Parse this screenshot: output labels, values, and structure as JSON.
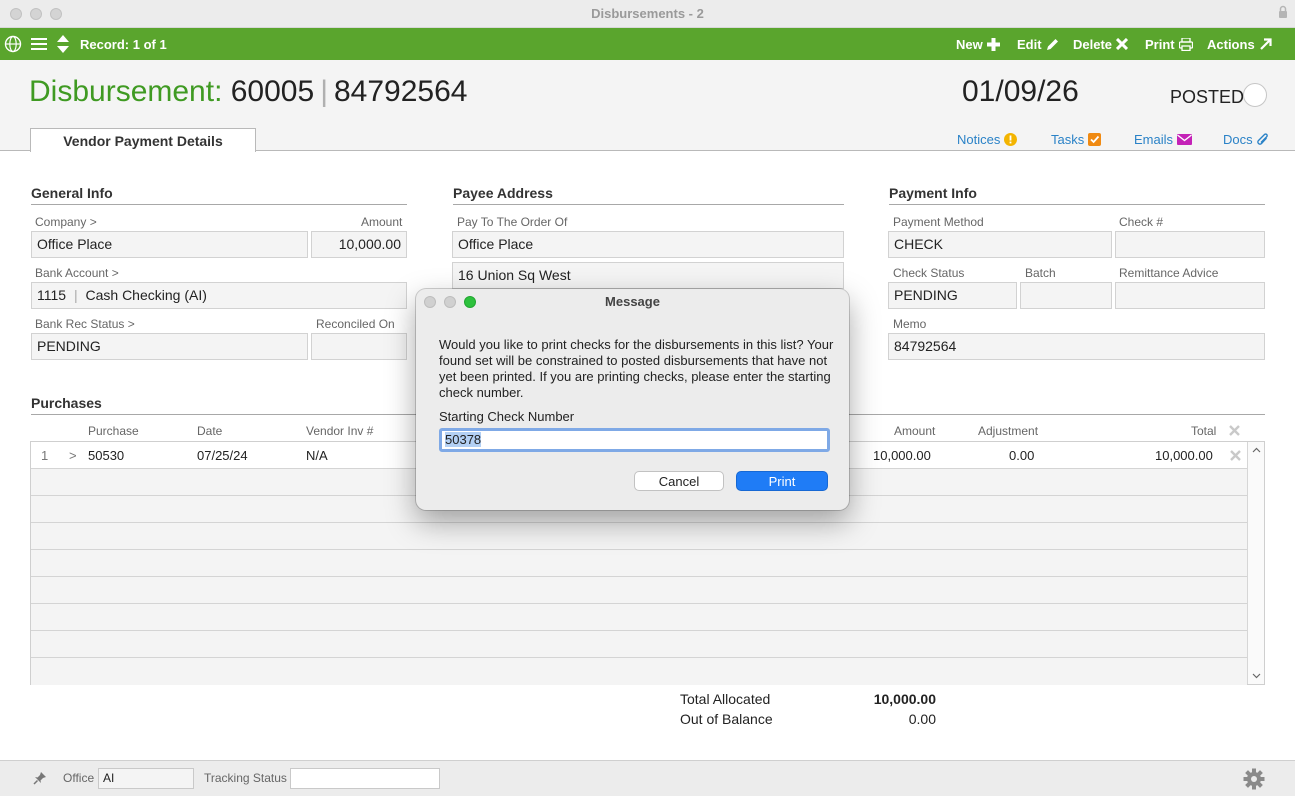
{
  "window": {
    "title": "Disbursements - 2"
  },
  "toolbar": {
    "record_label": "Record: 1 of 1",
    "new_label": "New",
    "edit_label": "Edit",
    "delete_label": "Delete",
    "print_label": "Print",
    "actions_label": "Actions"
  },
  "header": {
    "label": "Disbursement:",
    "number": "60005",
    "ref": "84792564",
    "date": "01/09/26",
    "status": "POSTED",
    "tab": "Vendor Payment Details",
    "links": {
      "notices": "Notices",
      "tasks": "Tasks",
      "emails": "Emails",
      "docs": "Docs"
    }
  },
  "general_info": {
    "title": "General Info",
    "company_label": "Company >",
    "company": "Office Place",
    "amount_label": "Amount",
    "amount": "10,000.00",
    "bank_account_label": "Bank Account >",
    "bank_account_code": "1115",
    "bank_account_name": "Cash Checking (AI)",
    "bank_rec_status_label": "Bank Rec Status >",
    "bank_rec_status": "PENDING",
    "reconciled_on_label": "Reconciled On",
    "reconciled_on": ""
  },
  "payee_address": {
    "title": "Payee Address",
    "pay_to_label": "Pay To The Order Of",
    "pay_to": "Office Place",
    "address_line1": "16 Union Sq West"
  },
  "payment_info": {
    "title": "Payment Info",
    "method_label": "Payment Method",
    "method": "CHECK",
    "check_no_label": "Check #",
    "check_no": "",
    "check_status_label": "Check Status",
    "check_status": "PENDING",
    "batch_label": "Batch",
    "batch": "",
    "remittance_label": "Remittance Advice",
    "remittance": "",
    "memo_label": "Memo",
    "memo": "84792564"
  },
  "purchases": {
    "title": "Purchases",
    "columns": [
      "Purchase",
      "Date",
      "Vendor Inv #",
      "Amount",
      "Adjustment",
      "Total"
    ],
    "rows": [
      {
        "index": "1",
        "purchase": "50530",
        "date": "07/25/24",
        "vendor_inv": "N/A",
        "amount": "10,000.00",
        "adjustment": "0.00",
        "total": "10,000.00"
      }
    ],
    "total_allocated_label": "Total Allocated",
    "total_allocated": "10,000.00",
    "out_of_balance_label": "Out of Balance",
    "out_of_balance": "0.00"
  },
  "footer": {
    "office_label": "Office",
    "office": "AI",
    "tracking_label": "Tracking Status",
    "tracking": ""
  },
  "dialog": {
    "title": "Message",
    "message": "Would you like to print checks for the disbursements in this list? Your found set will be constrained to posted disbursements that have not yet been printed. If you are printing checks, please enter the starting check number.",
    "field_label": "Starting Check Number",
    "field_value": "50378",
    "cancel_label": "Cancel",
    "print_label": "Print"
  },
  "colors": {
    "toolbar_green": "#5aa52d",
    "title_green": "#3f9a22",
    "link_blue": "#2a82c7",
    "primary_button": "#1f7cf6"
  }
}
